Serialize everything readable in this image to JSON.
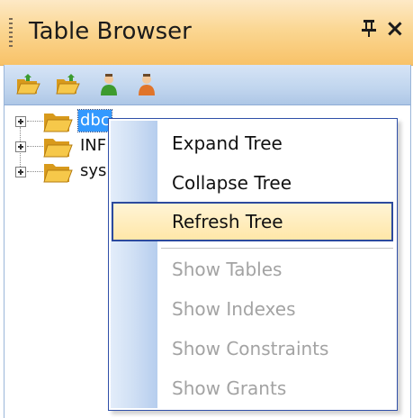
{
  "panel": {
    "title": "Table Browser",
    "pin_glyph": "Ԅ",
    "close_glyph": "×"
  },
  "toolbar": {
    "buttons": [
      {
        "icon": "open-folder-icon"
      },
      {
        "icon": "folder-icon"
      },
      {
        "icon": "user-green-icon"
      },
      {
        "icon": "user-orange-icon"
      }
    ]
  },
  "tree": {
    "nodes": [
      {
        "label": "dbc",
        "selected": true,
        "icon": "folder-icon"
      },
      {
        "label": "INF",
        "selected": false,
        "icon": "folder-icon"
      },
      {
        "label": "sys",
        "selected": false,
        "icon": "folder-icon"
      }
    ]
  },
  "context_menu": {
    "items": [
      {
        "label": "Expand Tree",
        "enabled": true
      },
      {
        "label": "Collapse Tree",
        "enabled": true
      },
      {
        "label": "Refresh Tree",
        "enabled": true,
        "highlighted": true
      },
      {
        "label": "Show Tables",
        "enabled": false
      },
      {
        "label": "Show Indexes",
        "enabled": false
      },
      {
        "label": "Show Constraints",
        "enabled": false
      },
      {
        "label": "Show Grants",
        "enabled": false
      }
    ]
  },
  "colors": {
    "title_bar": "#f8c268",
    "toolbar": "#c0d5ee",
    "selection": "#3399ff",
    "menu_border": "#2f4fa8",
    "hover_fill": "#ffe7a8",
    "disabled_text": "#a3a3a3"
  }
}
